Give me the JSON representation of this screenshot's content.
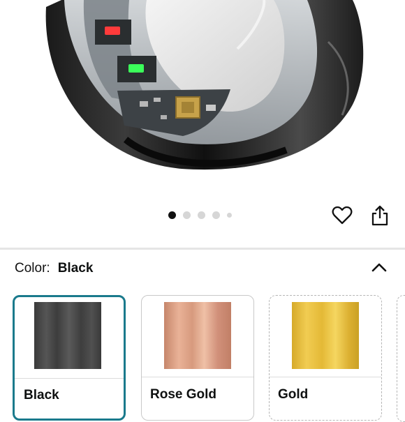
{
  "product_image": {
    "icon": "smart-ring-photo"
  },
  "carousel": {
    "dots": 5,
    "active_index": 0
  },
  "actions": {
    "wishlist_icon": "heart-icon",
    "share_icon": "share-icon"
  },
  "color_selector": {
    "label": "Color:",
    "selected_value": "Black",
    "collapse_icon": "chevron-up-icon",
    "options": [
      {
        "name": "Black",
        "selected": true,
        "swatch_color": "#464646"
      },
      {
        "name": "Rose Gold",
        "selected": false,
        "swatch_color": "#e0a68b"
      },
      {
        "name": "Gold",
        "selected": false,
        "swatch_color": "#e8bf3e"
      }
    ]
  },
  "colors": {
    "selected_border": "#1a7a8c",
    "led_red": "#ff3b3b",
    "led_green": "#3bff5a"
  }
}
